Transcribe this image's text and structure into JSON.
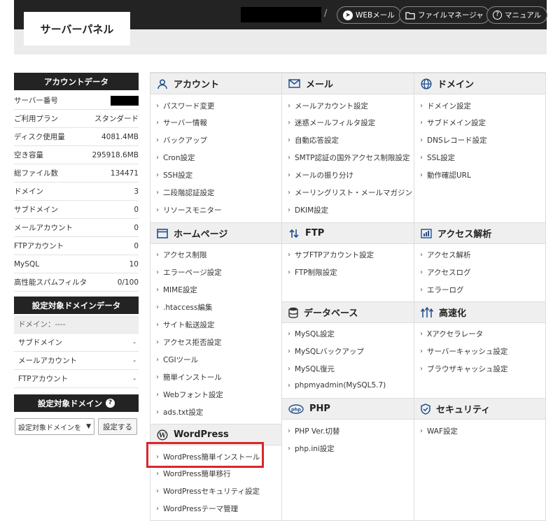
{
  "header": {
    "logo": "サーバーパネル",
    "separator": "/",
    "buttons": [
      {
        "label": "WEBメール",
        "icon": "send-icon"
      },
      {
        "label": "ファイルマネージャ",
        "icon": "folder-icon"
      },
      {
        "label": "マニュアル",
        "icon": "help-icon"
      }
    ]
  },
  "sidebar": {
    "account_title": "アカウントデータ",
    "account_rows": [
      {
        "label": "サーバー番号",
        "value": ""
      },
      {
        "label": "ご利用プラン",
        "value": "スタンダード"
      },
      {
        "label": "ディスク使用量",
        "value": "4081.4MB"
      },
      {
        "label": "空き容量",
        "value": "295918.6MB"
      },
      {
        "label": "総ファイル数",
        "value": "134471"
      },
      {
        "label": "ドメイン",
        "value": "3"
      },
      {
        "label": "サブドメイン",
        "value": "0"
      },
      {
        "label": "メールアカウント",
        "value": "0"
      },
      {
        "label": "FTPアカウント",
        "value": "0"
      },
      {
        "label": "MySQL",
        "value": "10"
      },
      {
        "label": "高性能スパムフィルタ",
        "value": "0/100"
      }
    ],
    "domain_data_title": "設定対象ドメインデータ",
    "domain_rows": [
      {
        "label": "ドメイン：----",
        "value": ""
      },
      {
        "label": "サブドメイン",
        "value": "-"
      },
      {
        "label": "メールアカウント",
        "value": "-"
      },
      {
        "label": "FTPアカウント",
        "value": "-"
      }
    ],
    "target_domain_title": "設定対象ドメイン",
    "select_value": "設定対象ドメインを",
    "set_button": "設定する"
  },
  "sections": {
    "account": {
      "title": "アカウント",
      "items": [
        "パスワード変更",
        "サーバー情報",
        "バックアップ",
        "Cron設定",
        "SSH設定",
        "二段階認証設定",
        "リソースモニター"
      ]
    },
    "mail": {
      "title": "メール",
      "items": [
        "メールアカウント設定",
        "迷惑メールフィルタ設定",
        "自動応答設定",
        "SMTP認証の国外アクセス制限設定",
        "メールの振り分け",
        "メーリングリスト・メールマガジン",
        "DKIM設定"
      ]
    },
    "domain": {
      "title": "ドメイン",
      "items": [
        "ドメイン設定",
        "サブドメイン設定",
        "DNSレコード設定",
        "SSL設定",
        "動作確認URL"
      ]
    },
    "homepage": {
      "title": "ホームページ",
      "items": [
        "アクセス制限",
        "エラーページ設定",
        "MIME設定",
        ".htaccess編集",
        "サイト転送設定",
        "アクセス拒否設定",
        "CGIツール",
        "簡単インストール",
        "Webフォント設定",
        "ads.txt設定"
      ]
    },
    "ftp": {
      "title": "FTP",
      "items": [
        "サブFTPアカウント設定",
        "FTP制限設定"
      ]
    },
    "analytics": {
      "title": "アクセス解析",
      "items": [
        "アクセス解析",
        "アクセスログ",
        "エラーログ"
      ]
    },
    "database": {
      "title": "データベース",
      "items": [
        "MySQL設定",
        "MySQLバックアップ",
        "MySQL復元",
        "phpmyadmin(MySQL5.7)"
      ]
    },
    "speed": {
      "title": "高速化",
      "items": [
        "Xアクセラレータ",
        "サーバーキャッシュ設定",
        "ブラウザキャッシュ設定"
      ]
    },
    "php": {
      "title": "PHP",
      "items": [
        "PHP Ver.切替",
        "php.ini設定"
      ]
    },
    "security": {
      "title": "セキュリティ",
      "items": [
        "WAF設定"
      ]
    },
    "wordpress": {
      "title": "WordPress",
      "items": [
        "WordPress簡単インストール",
        "WordPress簡単移行",
        "WordPressセキュリティ設定",
        "WordPressテーマ管理"
      ]
    }
  },
  "colors": {
    "dark": "#232323",
    "highlight": "#d9262c",
    "section_bg": "#efefef",
    "icon_blue": "#1f4f8f"
  }
}
